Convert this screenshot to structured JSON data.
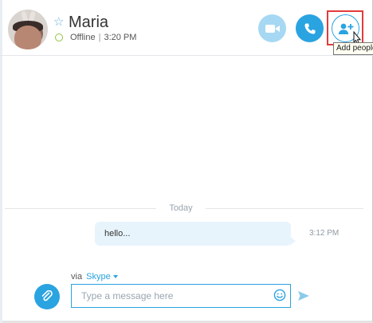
{
  "contact": {
    "name": "Maria",
    "status": "Offline",
    "time": "3:20 PM"
  },
  "header_buttons": {
    "video_icon": "video-camera-icon",
    "call_icon": "phone-icon",
    "add_people_icon": "add-person-icon",
    "tooltip": "Add people"
  },
  "conversation": {
    "date_label": "Today",
    "messages": [
      {
        "text": "hello...",
        "time": "3:12 PM"
      }
    ]
  },
  "composer": {
    "via_label": "via",
    "service": "Skype",
    "placeholder": "Type a message here",
    "attach_icon": "paperclip-icon",
    "emoji_icon": "emoticon-icon",
    "send_icon": "send-icon"
  },
  "colors": {
    "accent": "#2aa3e1",
    "accent_light": "#a6d8f3",
    "bubble": "#e8f4fc",
    "presence_offline": "#8fc640",
    "highlight": "#e33b3b"
  }
}
